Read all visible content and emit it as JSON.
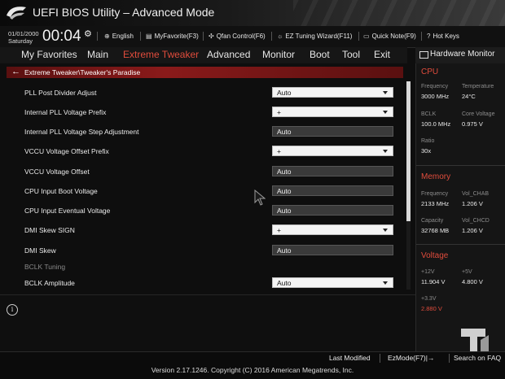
{
  "header": {
    "title": "UEFI BIOS Utility – Advanced Mode",
    "date": "01/01/2000",
    "day": "Saturday",
    "time": "00:04",
    "items": [
      {
        "label": "English",
        "icon": "globe-icon"
      },
      {
        "label": "MyFavorite(F3)",
        "icon": "favorite-icon"
      },
      {
        "label": "Qfan Control(F6)",
        "icon": "fan-icon"
      },
      {
        "label": "EZ Tuning Wizard(F11)",
        "icon": "wizard-icon"
      },
      {
        "label": "Quick Note(F9)",
        "icon": "note-icon"
      },
      {
        "label": "Hot Keys",
        "icon": "help-icon"
      }
    ]
  },
  "menu": {
    "tabs": [
      "My Favorites",
      "Main",
      "Extreme Tweaker",
      "Advanced",
      "Monitor",
      "Boot",
      "Tool",
      "Exit"
    ],
    "active": "Extreme Tweaker",
    "accent": "#e04c3c"
  },
  "breadcrumb": "Extreme Tweaker\\Tweaker's Paradise",
  "settings": [
    {
      "label": "PLL Post Divider Adjust",
      "value": "Auto",
      "type": "dropdown"
    },
    {
      "label": "Internal PLL Voltage Prefix",
      "value": "+",
      "type": "dropdown"
    },
    {
      "label": "Internal PLL Voltage Step Adjustment",
      "value": "Auto",
      "type": "input"
    },
    {
      "label": "VCCU Voltage Offset Prefix",
      "value": "+",
      "type": "dropdown"
    },
    {
      "label": "VCCU Voltage Offset",
      "value": "Auto",
      "type": "input"
    },
    {
      "label": "CPU Input Boot Voltage",
      "value": "Auto",
      "type": "input"
    },
    {
      "label": "CPU Input Eventual Voltage",
      "value": "Auto",
      "type": "input"
    },
    {
      "label": "DMI Skew SIGN",
      "value": "+",
      "type": "dropdown"
    },
    {
      "label": "DMI Skew",
      "value": "Auto",
      "type": "input"
    },
    {
      "label": "BCLK Tuning",
      "value": "",
      "type": "header"
    },
    {
      "label": "BCLK Amplitude",
      "value": "Auto",
      "type": "dropdown"
    }
  ],
  "hardware_monitor": {
    "title": "Hardware Monitor",
    "cpu": {
      "title": "CPU",
      "frequency_label": "Frequency",
      "frequency": "3000 MHz",
      "temperature_label": "Temperature",
      "temperature": "24°C",
      "bclk_label": "BCLK",
      "bclk": "100.0 MHz",
      "core_voltage_label": "Core Voltage",
      "core_voltage": "0.975 V",
      "ratio_label": "Ratio",
      "ratio": "30x"
    },
    "memory": {
      "title": "Memory",
      "frequency_label": "Frequency",
      "frequency": "2133 MHz",
      "vol_chab_label": "Vol_CHAB",
      "vol_chab": "1.206 V",
      "capacity_label": "Capacity",
      "capacity": "32768 MB",
      "vol_chcd_label": "Vol_CHCD",
      "vol_chcd": "1.206 V"
    },
    "voltage": {
      "title": "Voltage",
      "v12_label": "+12V",
      "v12": "11.904 V",
      "v5_label": "+5V",
      "v5": "4.800 V",
      "v33_label": "+3.3V",
      "v33": "2.880 V"
    }
  },
  "footer": {
    "last_modified": "Last Modified",
    "ezmode": "EzMode(F7)|→",
    "search_faq": "Search on FAQ",
    "version": "Version 2.17.1246. Copyright (C) 2016 American Megatrends, Inc."
  }
}
